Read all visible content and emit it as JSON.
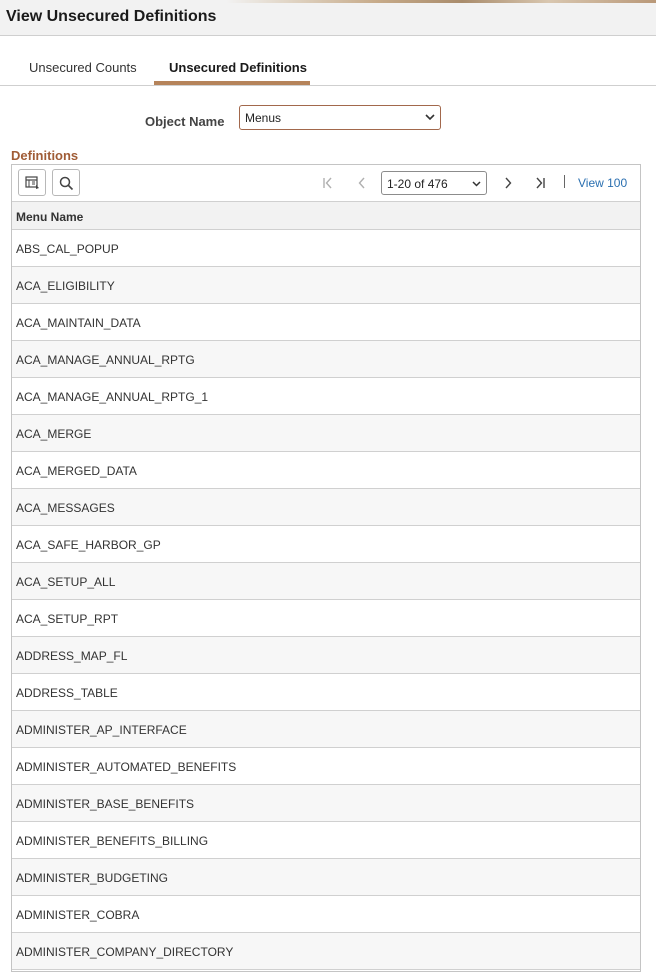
{
  "page": {
    "title": "View Unsecured Definitions"
  },
  "tabs": [
    {
      "label": "Unsecured Counts",
      "active": false
    },
    {
      "label": "Unsecured Definitions",
      "active": true
    }
  ],
  "filter": {
    "label": "Object Name",
    "value": "Menus"
  },
  "definitions": {
    "title": "Definitions",
    "pager": {
      "range": "1-20 of 476",
      "view_all": "View 100"
    },
    "column_header": "Menu Name",
    "rows": [
      "ABS_CAL_POPUP",
      "ACA_ELIGIBILITY",
      "ACA_MAINTAIN_DATA",
      "ACA_MANAGE_ANNUAL_RPTG",
      "ACA_MANAGE_ANNUAL_RPTG_1",
      "ACA_MERGE",
      "ACA_MERGED_DATA",
      "ACA_MESSAGES",
      "ACA_SAFE_HARBOR_GP",
      "ACA_SETUP_ALL",
      "ACA_SETUP_RPT",
      "ADDRESS_MAP_FL",
      "ADDRESS_TABLE",
      "ADMINISTER_AP_INTERFACE",
      "ADMINISTER_AUTOMATED_BENEFITS",
      "ADMINISTER_BASE_BENEFITS",
      "ADMINISTER_BENEFITS_BILLING",
      "ADMINISTER_BUDGETING",
      "ADMINISTER_COBRA",
      "ADMINISTER_COMPANY_DIRECTORY"
    ]
  },
  "colors": {
    "accent": "#a05c36",
    "tab_underline": "#b5835a",
    "link": "#2a6fb0"
  },
  "icons": [
    "personalize-grid-icon",
    "search-icon",
    "first-page-icon",
    "previous-page-icon",
    "chevron-down-icon",
    "next-page-icon",
    "last-page-icon"
  ]
}
